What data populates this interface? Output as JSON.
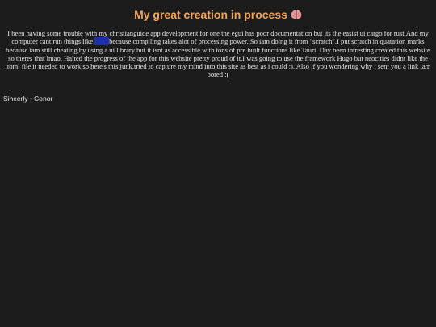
{
  "page": {
    "title": "My great creation in process",
    "title_icon": "brain-icon",
    "colors": {
      "background": "#1c1c1c",
      "title": "#f4a35a",
      "text": "#e6e6e6",
      "link": "#1f38b8"
    }
  },
  "paragraph": {
    "part1": "I been having some trouble with my christianguide app development for one the egui has poor documentation but its the easist ui cargo for rust.And my computer cant run things like ",
    "link_text": "Tauri",
    "part2": "because compiling takes alot of processing power. So iam doing it from \"scratch\".I put scratch in quatation marks because iam still cheating by using a ui library but it isnt as accessible with tons of pre built functions like Tauri. Day been intresting created this website so theres that lmao. Halted the progress of the app for this website pretty proud of it.I was going to use the framework Hugo but neocities didnt like the .toml file it needed to work so here's this junk.tried to capture my mind into this site as best as i could :). Also if you wondering why i sent you a link iam bored :("
  },
  "signature": "Sincerly ~Conor"
}
